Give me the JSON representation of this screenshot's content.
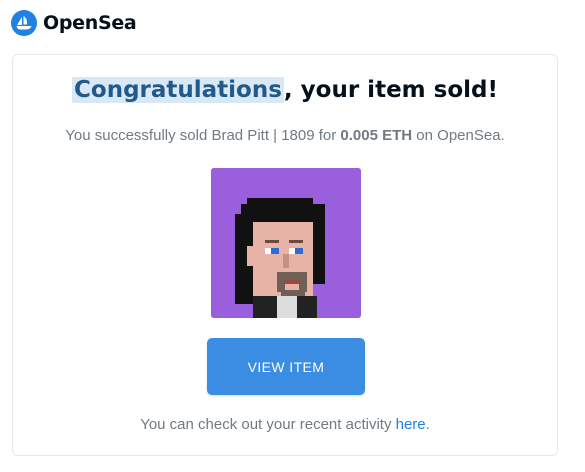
{
  "brand": {
    "name": "OpenSea",
    "accent": "#2081e2"
  },
  "email": {
    "headline_highlight": "Congratulations",
    "headline_rest": ", your item sold!",
    "sub_prefix": "You successfully sold Brad Pitt | 1809 for ",
    "sub_price": "0.005 ETH",
    "sub_suffix": " on OpenSea.",
    "item_image_icon": "pixel-punk-avatar",
    "view_button_label": "VIEW ITEM",
    "footer_prefix": "You can check out your recent activity ",
    "footer_link": "here",
    "footer_suffix": "."
  }
}
